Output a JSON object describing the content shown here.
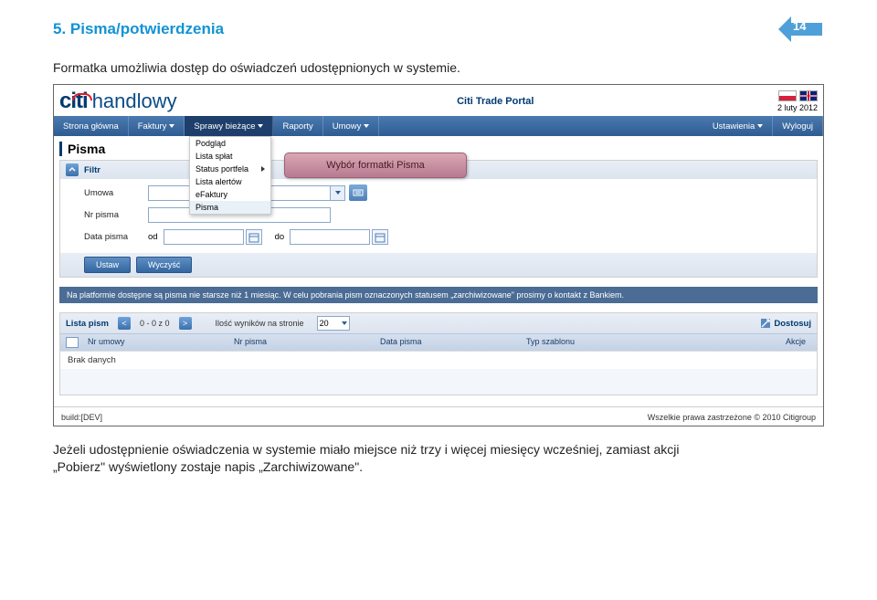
{
  "doc": {
    "title": "5. Pisma/potwierdzenia",
    "page_number": "14",
    "subtitle": "Formatka umożliwia dostęp do oświadczeń udostępnionych  w systemie.",
    "footer1": "Jeżeli  udostępnienie  oświadczenia w systemie  miało miejsce niż trzy i więcej miesięcy  wcześniej, zamiast akcji",
    "footer2": "„Pobierz\" wyświetlony zostaje napis „Zarchiwizowane\"."
  },
  "app": {
    "brand_left": "citi",
    "brand_right": "handlowy",
    "portal_title": "Citi Trade Portal",
    "date": "2 luty 2012",
    "nav": {
      "home": "Strona główna",
      "faktury": "Faktury",
      "sprawy": "Sprawy bieżące",
      "raporty": "Raporty",
      "umowy": "Umowy",
      "ustawienia": "Ustawienia",
      "wyloguj": "Wyloguj"
    },
    "section_title": "Pisma",
    "dropdown": {
      "item1": "Podgląd",
      "item2": "Lista spłat",
      "item3": "Status portfela",
      "item4": "Lista alertów",
      "item5": "eFaktury",
      "item6": "Pisma"
    },
    "callout": "Wybór formatki Pisma",
    "filter": {
      "head": "Filtr",
      "umowa": "Umowa",
      "nr_pisma": "Nr pisma",
      "data_pisma": "Data pisma",
      "od": "od",
      "do": "do",
      "btn_ustaw": "Ustaw",
      "btn_wyczysc": "Wyczyść"
    },
    "info": "Na platformie dostępne są pisma nie starsze niż 1 miesiąc. W celu pobrania pism oznaczonych statusem „zarchiwizowane\" prosimy o kontakt z Bankiem.",
    "list": {
      "title": "Lista pism",
      "range": "0 - 0 z 0",
      "perpage_label": "Ilość wyników na stronie",
      "perpage_value": "20",
      "dostosuj": "Dostosuj",
      "col1": "Nr umowy",
      "col2": "Nr pisma",
      "col3": "Data pisma",
      "col4": "Typ szablonu",
      "col5": "Akcje",
      "empty": "Brak danych"
    },
    "footer_left": "build:[DEV]",
    "footer_right": "Wszelkie prawa zastrzeżone © 2010 Citigroup"
  }
}
